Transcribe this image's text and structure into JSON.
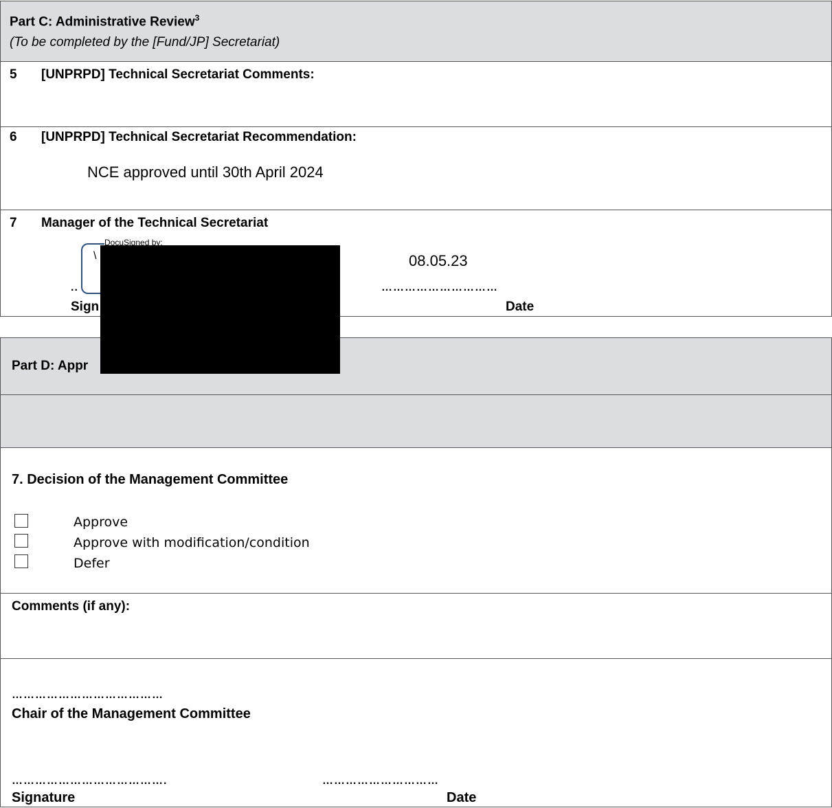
{
  "part_c": {
    "title": "Part C: Administrative Review",
    "footnote": "3",
    "subtitle": "(To be completed by the [Fund/JP] Secretariat)",
    "s5": {
      "num": "5",
      "label": "[UNPRPD] Technical Secretariat Comments:"
    },
    "s6": {
      "num": "6",
      "label": "[UNPRPD] Technical Secretariat Recommendation:",
      "value": "NCE approved until 30th April 2024"
    },
    "s7": {
      "num": "7",
      "label": "Manager of the Technical Secretariat",
      "docusign_label": "DocuSigned by:",
      "date_value": "08.05.23",
      "sig_dots": "..",
      "date_dots": "…………………………",
      "signature_label": "Sign",
      "date_label": "Date"
    }
  },
  "part_d": {
    "title": "Part D: Appr",
    "decision": {
      "heading": "7. Decision of the Management Committee",
      "options": [
        "Approve",
        "Approve with modification/condition",
        "Defer"
      ]
    },
    "comments_label": "Comments (if any):",
    "chair_dots": "…………………………………",
    "chair_label": "Chair of the Management Committee",
    "sig_dots": "………………………………….",
    "date_dots": "…………………………",
    "signature_label": "Signature",
    "date_label": "Date"
  },
  "colors": {
    "header_bg": "#dcdde0",
    "redaction": "#000000",
    "docusign_border": "#2f4f7f"
  }
}
